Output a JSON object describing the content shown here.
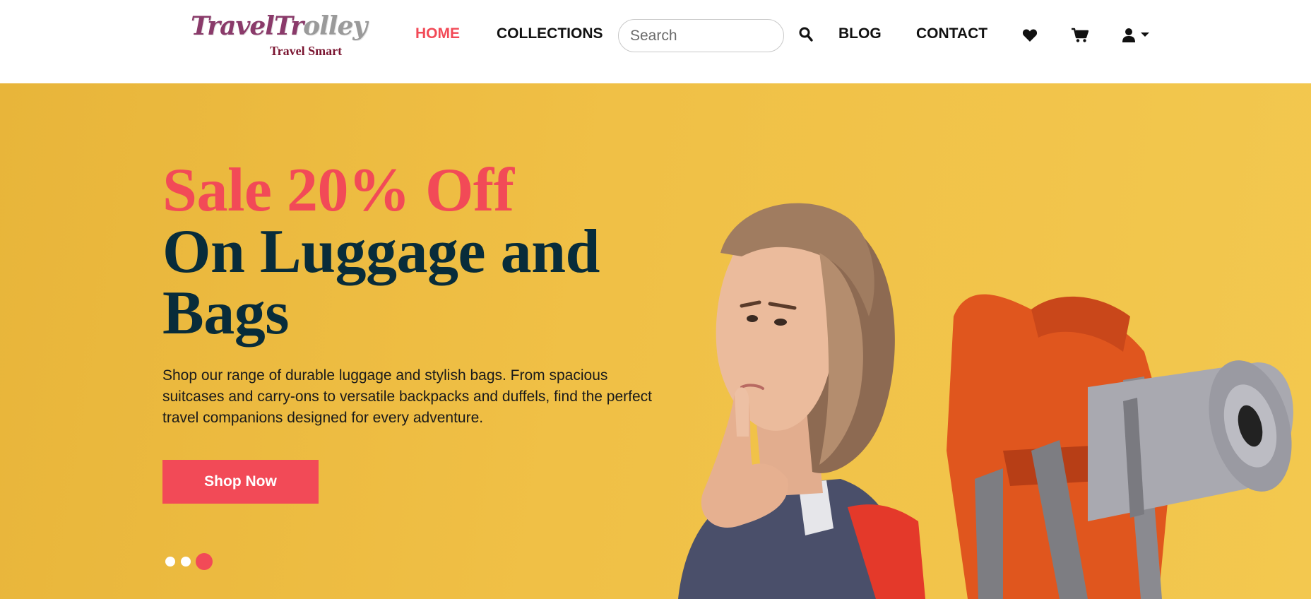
{
  "header": {
    "logo": {
      "script": "TravelTrolley",
      "script_head": "TravelTr",
      "script_tail": "olley",
      "tagline": "Travel Smart"
    },
    "nav": {
      "home": "HOME",
      "collections": "COLLECTIONS",
      "blog": "BLOG",
      "contact": "CONTACT"
    },
    "search": {
      "placeholder": "Search",
      "value": ""
    },
    "icons": {
      "search": "search-icon",
      "wishlist": "heart-icon",
      "cart": "cart-icon",
      "account": "user-icon",
      "account_caret": "caret-down-icon"
    }
  },
  "hero": {
    "headline_line1": "Sale 20% Off",
    "headline_line2": "On Luggage and",
    "headline_line3": "Bags",
    "description": "Shop our range of durable luggage and stylish bags. From spacious suitcases and carry-ons to versatile backpacks and duffels, find the perfect travel companions designed for every adventure.",
    "cta_label": "Shop Now",
    "carousel": {
      "slides": 3,
      "active_index": 2
    }
  },
  "colors": {
    "accent": "#f24a57",
    "heading_dark": "#082c3a",
    "hero_background": "#f0c046",
    "logo_primary": "#8a3a6a",
    "logo_tagline": "#7a1430"
  }
}
